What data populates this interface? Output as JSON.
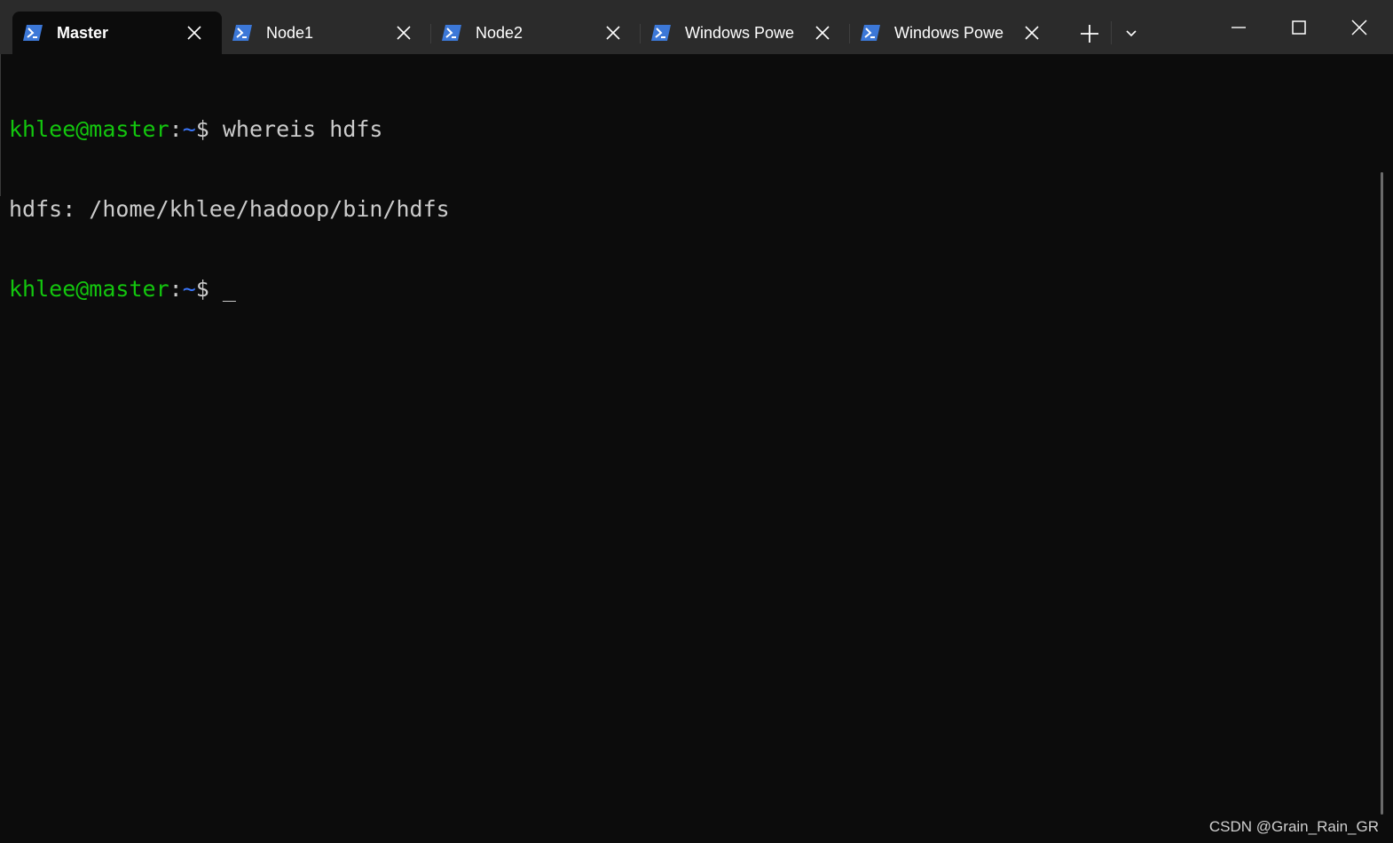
{
  "tabs": [
    {
      "label": "Master",
      "active": true,
      "icon": "powershell-icon"
    },
    {
      "label": "Node1",
      "active": false,
      "icon": "powershell-icon"
    },
    {
      "label": "Node2",
      "active": false,
      "icon": "powershell-icon"
    },
    {
      "label": "Windows PowerShell",
      "active": false,
      "icon": "powershell-icon"
    },
    {
      "label": "Windows PowerShell",
      "active": false,
      "icon": "powershell-icon"
    }
  ],
  "terminal": {
    "lines": [
      {
        "user_host": "khlee@master",
        "colon": ":",
        "path": "~",
        "prompt": "$ ",
        "command": "whereis hdfs"
      },
      {
        "output": "hdfs: /home/khlee/hadoop/bin/hdfs"
      },
      {
        "user_host": "khlee@master",
        "colon": ":",
        "path": "~",
        "prompt": "$ ",
        "command": "_"
      }
    ]
  },
  "watermark": "CSDN @Grain_Rain_GR",
  "colors": {
    "background": "#0c0c0c",
    "titlebar": "#2b2b2b",
    "prompt_user": "#13c60e",
    "prompt_path": "#3b78ff",
    "text": "#cccccc",
    "icon_blue": "#3c78d8"
  }
}
